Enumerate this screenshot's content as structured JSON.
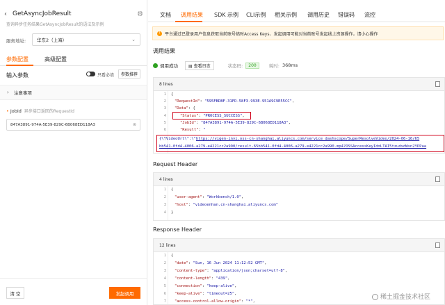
{
  "left": {
    "title": "GetAsyncJobResult",
    "subtitle": "查询异步任务结果GetAsyncJobResult的语法及示例",
    "region_label": "服务地址:",
    "region_value": "华东2（上海）",
    "tabs": [
      "参数配置",
      "高级配置"
    ],
    "input_title": "输入参数",
    "only_required": "只看必填",
    "recommend_label": "参数推荐",
    "notice_label": "注意事项",
    "jobid_label": "JobId",
    "jobid_hint": "异步接口返回的RequestId",
    "jobid_value": "847A3891-974A-5E39-829C-6B068ED118A3",
    "clear_label": "清 空",
    "send_label": "发起调用"
  },
  "right": {
    "tabs": [
      "文档",
      "调用结果",
      "SDK 示例",
      "CLI示例",
      "相关示例",
      "调用历史",
      "错误码",
      "流控"
    ],
    "banner": "平台通过已登录用户信息获取当前账号临时Access Keys、发起调用可能对当前账号发起线上资源操作，请小心操作",
    "result_title": "调用结果",
    "call_success": "调用成功",
    "view_log": "查看日志",
    "status_code_label": "状态码:",
    "status_code": "200",
    "time_label": "耗时:",
    "time_value": "368ms",
    "result_lines": "8 lines",
    "result_code": {
      "l1": "{",
      "l2k": "\"RequestId\"",
      "l2v": "\"595FBDBF-31FD-58F3-993E-951A9C9E55CC\"",
      "l3k": "\"Data\"",
      "l3v": "{",
      "l4k": "\"Status\"",
      "l4v": "\"PROCESS_SUCCESS\"",
      "l5k": "\"JobId\"",
      "l5v": "\"847A3891-974A-5E39-829C-6B068ED118A3\"",
      "l6k": "\"Result\"",
      "l6v": "\"",
      "l7a": "{\\\"VideoUrl\\\":\\\"",
      "l7b": "https://vigen-invi.oss-cn-shanghai.aliyuncs.com/service_dashscope/SuperResolveVideo/2024-06-16/65",
      "l7c": "bb541-0fd4-4006-a279-e4221cc2a990/result-65bb541-0fd4-4006-a279-e4221cc2a990.mp4?OSSAccessKeyId=LTAI5tzudxdWsn2YPPaa"
    },
    "request_header_title": "Request Header",
    "request_lines": "4 lines",
    "request_code": {
      "l1": "{",
      "l2k": "\"user-agent\"",
      "l2v": "\"Workbench/1.0\"",
      "l3k": "\"host\"",
      "l3v": "\"videoenhan.cn-shanghai.aliyuncs.com\"",
      "l4": "}"
    },
    "response_header_title": "Response Header",
    "response_lines": "12 lines",
    "response_code": {
      "l1": "{",
      "l2k": "\"date\"",
      "l2v": "\"Sun, 16 Jun 2024 11:12:52 GMT\"",
      "l3k": "\"content-type\"",
      "l3v": "\"application/json;charset=utf-8\"",
      "l4k": "\"content-length\"",
      "l4v": "\"439\"",
      "l5k": "\"connection\"",
      "l5v": "\"keep-alive\"",
      "l6k": "\"keep-alive\"",
      "l6v": "\"timeout=25\"",
      "l7k": "\"access-control-allow-origin\"",
      "l7v": "\"*\""
    },
    "watermark": "稀土掘金技术社区"
  },
  "colors": {
    "accent": "#ff6a00",
    "success": "#2ea121",
    "highlight": "#d0021b"
  }
}
